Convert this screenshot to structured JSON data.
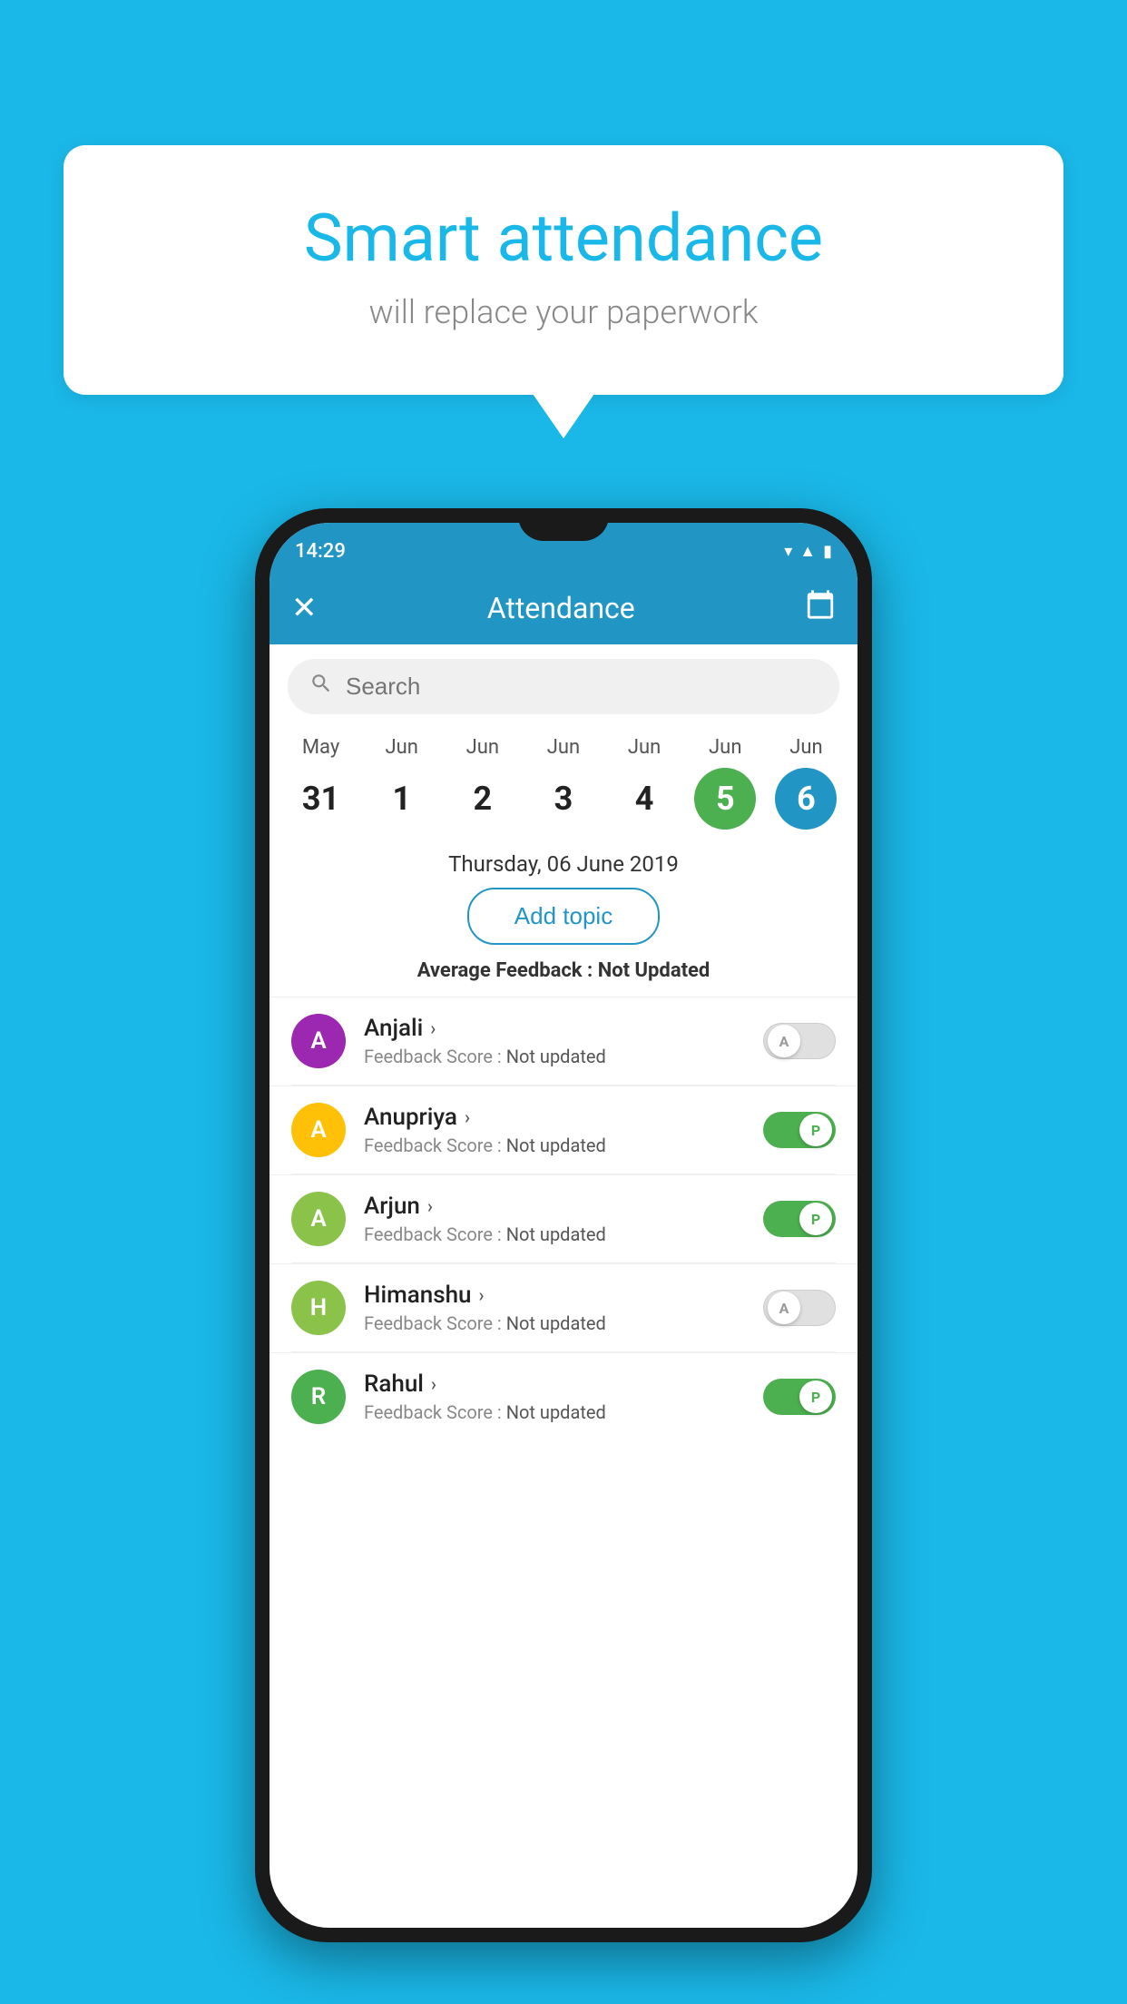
{
  "background_color": "#1ab8e8",
  "speech_bubble": {
    "title": "Smart attendance",
    "subtitle": "will replace your paperwork"
  },
  "status_bar": {
    "time": "14:29",
    "icons": [
      "wifi",
      "signal",
      "battery"
    ]
  },
  "app_bar": {
    "title": "Attendance",
    "close_label": "×",
    "calendar_icon": "📅"
  },
  "search": {
    "placeholder": "Search"
  },
  "calendar": {
    "days": [
      {
        "month": "May",
        "date": "31",
        "state": "normal"
      },
      {
        "month": "Jun",
        "date": "1",
        "state": "normal"
      },
      {
        "month": "Jun",
        "date": "2",
        "state": "normal"
      },
      {
        "month": "Jun",
        "date": "3",
        "state": "normal"
      },
      {
        "month": "Jun",
        "date": "4",
        "state": "normal"
      },
      {
        "month": "Jun",
        "date": "5",
        "state": "today"
      },
      {
        "month": "Jun",
        "date": "6",
        "state": "selected"
      }
    ]
  },
  "selected_date_label": "Thursday, 06 June 2019",
  "add_topic_button": "Add topic",
  "average_feedback": {
    "label": "Average Feedback : ",
    "value": "Not Updated"
  },
  "students": [
    {
      "name": "Anjali",
      "initial": "A",
      "avatar_color": "#9c27b0",
      "feedback_label": "Feedback Score : ",
      "feedback_value": "Not updated",
      "toggle_state": "off",
      "toggle_label": "A"
    },
    {
      "name": "Anupriya",
      "initial": "A",
      "avatar_color": "#ffc107",
      "feedback_label": "Feedback Score : ",
      "feedback_value": "Not updated",
      "toggle_state": "on",
      "toggle_label": "P"
    },
    {
      "name": "Arjun",
      "initial": "A",
      "avatar_color": "#8bc34a",
      "feedback_label": "Feedback Score : ",
      "feedback_value": "Not updated",
      "toggle_state": "on",
      "toggle_label": "P"
    },
    {
      "name": "Himanshu",
      "initial": "H",
      "avatar_color": "#8bc34a",
      "feedback_label": "Feedback Score : ",
      "feedback_value": "Not updated",
      "toggle_state": "off",
      "toggle_label": "A"
    },
    {
      "name": "Rahul",
      "initial": "R",
      "avatar_color": "#4caf50",
      "feedback_label": "Feedback Score : ",
      "feedback_value": "Not updated",
      "toggle_state": "on",
      "toggle_label": "P"
    }
  ]
}
